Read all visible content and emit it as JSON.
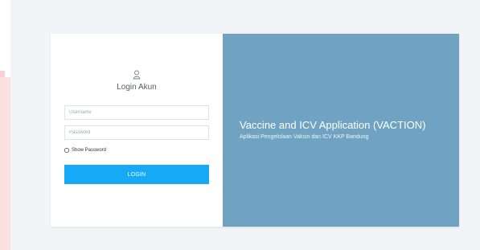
{
  "login": {
    "title": "Login Akun",
    "username_placeholder": "Username",
    "password_placeholder": "Password",
    "show_password_label": "Show Password",
    "login_button_label": "LOGIN"
  },
  "info": {
    "app_title": "Vaccine and ICV Application (VACTION)",
    "app_subtitle": "Aplikasi Pengelolaan Vaksin dan ICV KKP Bandung"
  },
  "colors": {
    "background": "#f3f4f7",
    "info_panel": "#6fa3c1",
    "button": "#16a9f5",
    "left_strip": "#fbe0e2"
  },
  "icons": [
    "user-icon"
  ]
}
